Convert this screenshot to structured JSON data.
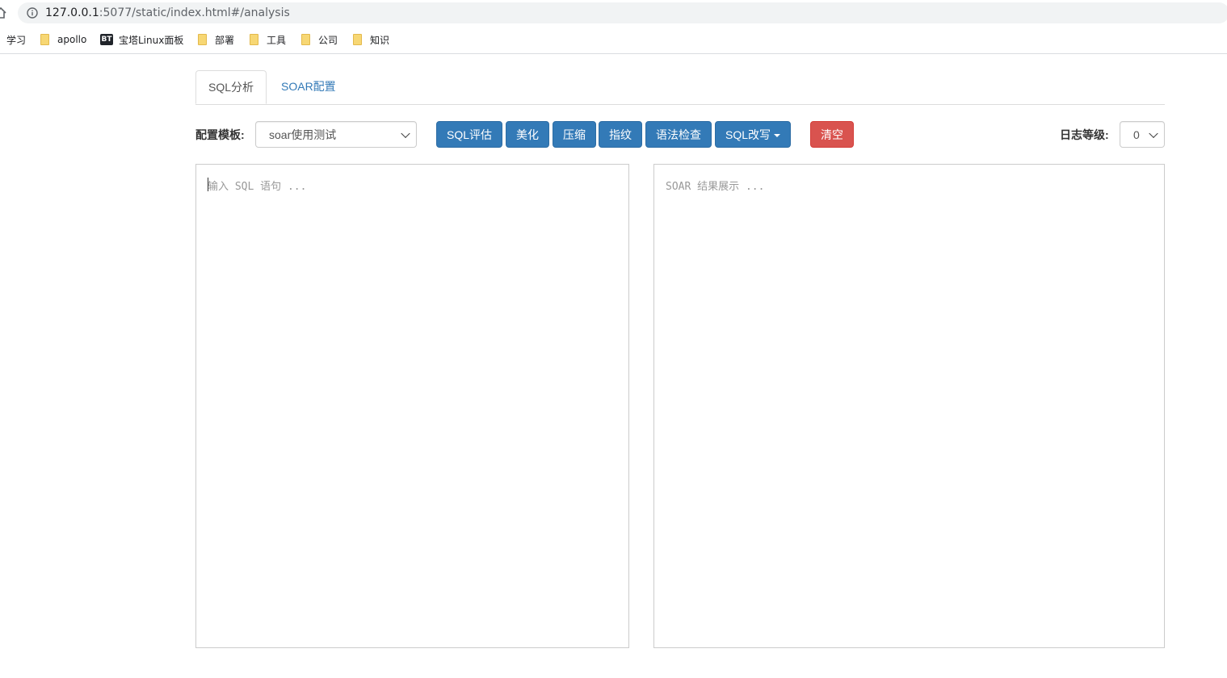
{
  "browser": {
    "url_host": "127.0.0.1",
    "url_rest": ":5077/static/index.html#/analysis",
    "bookmarks": [
      {
        "label": "学习",
        "icon": "none"
      },
      {
        "label": "apollo",
        "icon": "folder-icon"
      },
      {
        "label": "宝塔Linux面板",
        "icon": "bt-icon",
        "badge": "BT"
      },
      {
        "label": "部署",
        "icon": "folder-icon"
      },
      {
        "label": "工具",
        "icon": "folder-icon"
      },
      {
        "label": "公司",
        "icon": "folder-icon"
      },
      {
        "label": "知识",
        "icon": "folder-icon"
      }
    ]
  },
  "tabs": [
    {
      "label": "SQL分析",
      "active": true
    },
    {
      "label": "SOAR配置",
      "active": false
    }
  ],
  "toolbar": {
    "template_label": "配置模板:",
    "template_value": "soar使用测试",
    "buttons": {
      "evaluate": "SQL评估",
      "beautify": "美化",
      "compress": "压缩",
      "fingerprint": "指纹",
      "syntax_check": "语法检查",
      "rewrite": "SQL改写",
      "clear": "清空"
    },
    "log_level_label": "日志等级:",
    "log_level_value": "0"
  },
  "editor": {
    "sql_placeholder": "输入 SQL 语句 ...",
    "result_placeholder": "SOAR 结果展示 ..."
  },
  "colors": {
    "primary": "#337ab7",
    "danger": "#d9534f",
    "link": "#337ab7"
  }
}
